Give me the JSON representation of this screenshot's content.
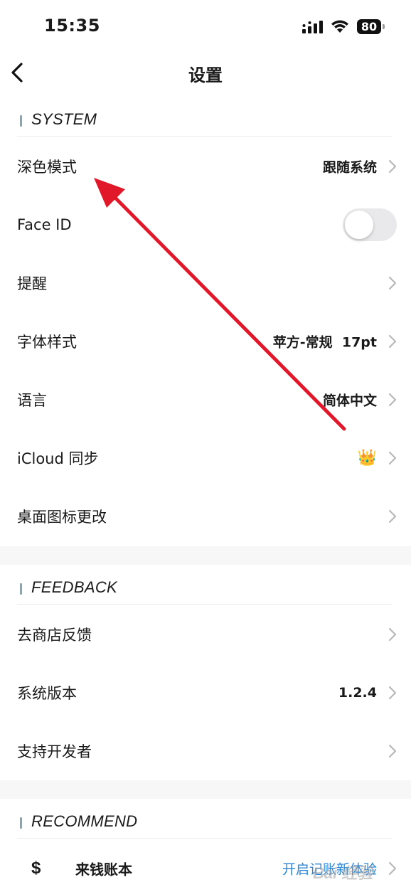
{
  "status": {
    "time": "15:35",
    "battery": "80"
  },
  "nav": {
    "title": "设置",
    "back_icon": "chevron-left-icon"
  },
  "sections": {
    "system": {
      "title": "SYSTEM",
      "items": [
        {
          "label": "深色模式",
          "value": "跟随系统"
        },
        {
          "label": "Face ID",
          "toggle": false
        },
        {
          "label": "提醒",
          "value": ""
        },
        {
          "label": "字体样式",
          "value": "苹方-常规  17pt"
        },
        {
          "label": "语言",
          "value": "简体中文"
        },
        {
          "label": "iCloud 同步",
          "value": "👑"
        },
        {
          "label": "桌面图标更改",
          "value": ""
        }
      ]
    },
    "feedback": {
      "title": "FEEDBACK",
      "items": [
        {
          "label": "去商店反馈",
          "value": ""
        },
        {
          "label": "系统版本",
          "value": "1.2.4"
        },
        {
          "label": "支持开发者",
          "value": ""
        }
      ]
    },
    "recommend": {
      "title": "RECOMMEND",
      "items": [
        {
          "icon": "$",
          "label": "来钱账本",
          "link": "开启记账新体验"
        }
      ]
    }
  },
  "watermark": "Bai 经验",
  "colors": {
    "accent_bar": "#8fa3a8",
    "link": "#2a86d9",
    "annotation_arrow": "#e0182a",
    "toggle_off": "#e9e9eb",
    "section_gap": "#f7f7f7"
  }
}
